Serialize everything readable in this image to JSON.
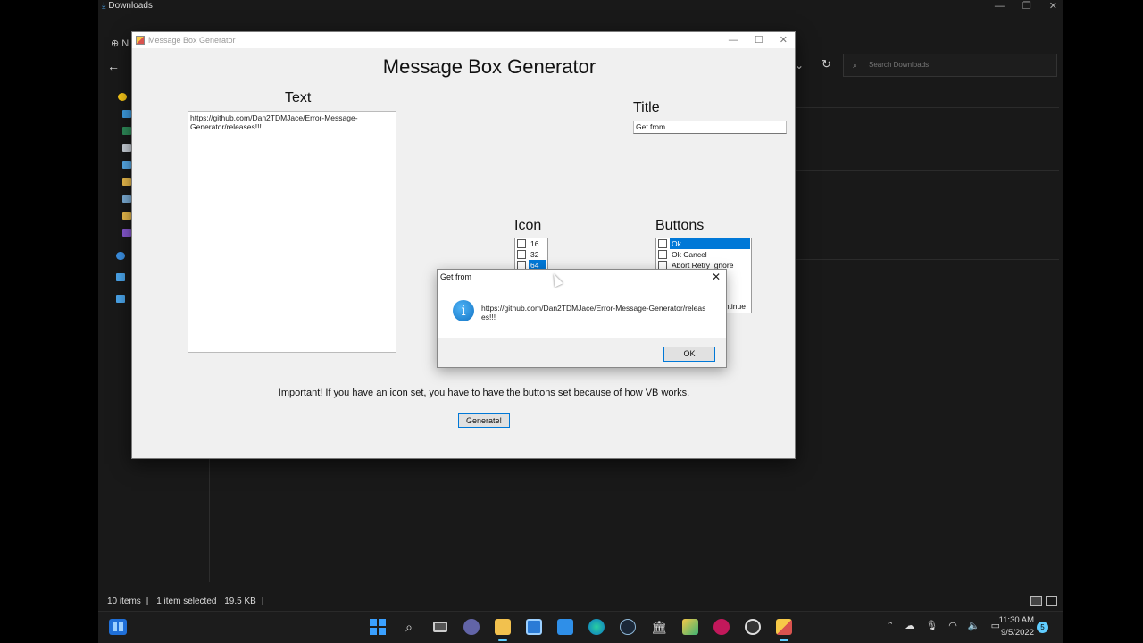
{
  "explorer": {
    "title": "Downloads",
    "new_label": "N",
    "search_placeholder": "Search Downloads",
    "status": {
      "items": "10 items",
      "selected": "1 item selected",
      "size": "19.5 KB"
    }
  },
  "generator": {
    "window_title": "Message Box Generator",
    "heading": "Message Box Generator",
    "text_label": "Text",
    "text_value": "https://github.com/Dan2TDMJace/Error-Message-Generator/releases!!!",
    "title_label": "Title",
    "title_value": "Get from",
    "icon_label": "Icon",
    "icon_options": [
      "16",
      "32",
      "64"
    ],
    "buttons_label": "Buttons",
    "button_options": [
      "Ok",
      "Ok Cancel",
      "Abort Retry Ignore"
    ],
    "button_options_partial": "ntinue",
    "note": "Important! If you have an icon set, you have to have the buttons set because of how VB works.",
    "generate_label": "Generate!"
  },
  "dialog": {
    "title": "Get from",
    "message": "https://github.com/Dan2TDMJace/Error-Message-Generator/releases!!!",
    "ok_label": "OK",
    "info_glyph": "i"
  },
  "taskbar": {
    "time": "11:30 AM",
    "date": "9/5/2022",
    "notifications": "5"
  },
  "colors": {
    "accent": "#0078d7",
    "taskbar_indicator": "#60cdff",
    "explorer_bg": "#191919"
  }
}
